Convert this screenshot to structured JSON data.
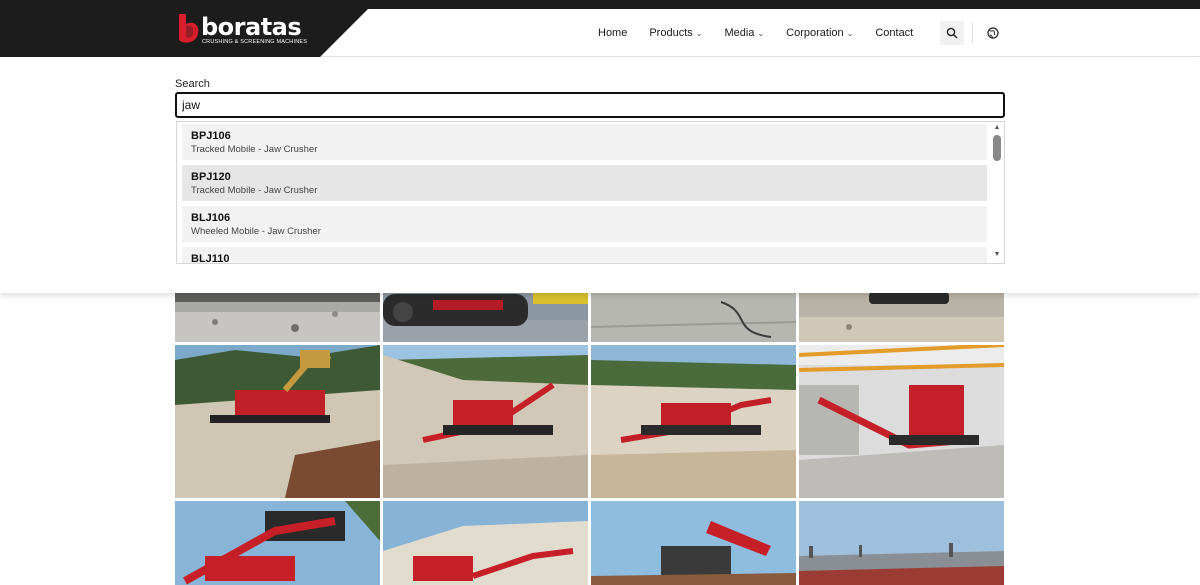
{
  "brand": {
    "name": "boratas",
    "tagline": "CRUSHING & SCREENING MACHINES",
    "color": "#d81e2c"
  },
  "nav": {
    "items": [
      {
        "label": "Home",
        "has_dropdown": false
      },
      {
        "label": "Products",
        "has_dropdown": true
      },
      {
        "label": "Media",
        "has_dropdown": true
      },
      {
        "label": "Corporation",
        "has_dropdown": true
      },
      {
        "label": "Contact",
        "has_dropdown": false
      }
    ],
    "icons": [
      "search-icon",
      "globe-icon"
    ]
  },
  "search": {
    "label": "Search",
    "value": "jaw",
    "results": [
      {
        "title": "BPJ106",
        "subtitle": "Tracked Mobile - Jaw Crusher"
      },
      {
        "title": "BPJ120",
        "subtitle": "Tracked Mobile - Jaw Crusher"
      },
      {
        "title": "BLJ106",
        "subtitle": "Wheeled Mobile - Jaw Crusher"
      },
      {
        "title": "BLJ110",
        "subtitle": ""
      }
    ]
  },
  "gallery": {
    "rows": 3,
    "columns": 4,
    "photos": [
      "quarry-gravel",
      "tracked-crusher-closeup",
      "concrete-cable",
      "tracked-machine-gravel",
      "jaw-crusher-forest-excavator",
      "crusher-sand-quarry",
      "crusher-quarry-hills",
      "crusher-factory-hall",
      "crusher-blue-sky",
      "crusher-white-quarry",
      "crusher-red-conveyor",
      "city-panorama"
    ]
  }
}
